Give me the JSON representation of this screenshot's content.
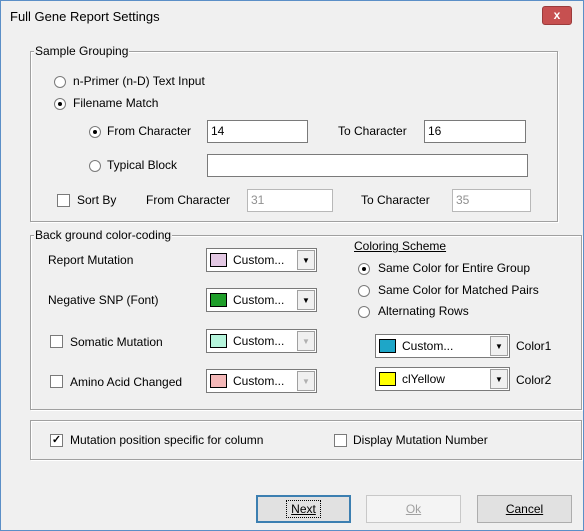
{
  "window": {
    "title": "Full Gene Report Settings",
    "close_glyph": "x"
  },
  "sample_grouping": {
    "group_label": "Sample Grouping",
    "n_primer_label": "n-Primer (n-D) Text Input",
    "filename_match_label": "Filename Match",
    "from_character_label": "From Character",
    "from_character_value": "14",
    "to_character_label": "To Character",
    "to_character_value": "16",
    "typical_block_label": "Typical Block",
    "typical_block_value": "",
    "sort_by_label": "Sort By",
    "sort_from_label": "From Character",
    "sort_from_value": "31",
    "sort_to_label": "To Character",
    "sort_to_value": "35"
  },
  "background_coloring": {
    "group_label": "Back ground color-coding",
    "report_mutation_label": "Report Mutation",
    "report_mutation_combo": "Custom...",
    "report_mutation_color": "#e3c8e3",
    "negative_snp_label": "Negative SNP (Font)",
    "negative_snp_combo": "Custom...",
    "negative_snp_color": "#1f9e2a",
    "somatic_mutation_label": "Somatic Mutation",
    "somatic_mutation_combo": "Custom...",
    "somatic_mutation_color": "#b6f5dc",
    "amino_acid_label": "Amino Acid Changed",
    "amino_acid_combo": "Custom...",
    "amino_acid_color": "#f4b8b8",
    "coloring_scheme_label": "Coloring Scheme",
    "same_color_group_label": "Same Color for Entire Group",
    "same_color_pairs_label": "Same Color for Matched Pairs",
    "alternating_rows_label": "Alternating Rows",
    "color1_combo": "Custom...",
    "color1_swatch": "#1ea6c8",
    "color1_label": "Color1",
    "color2_combo": "clYellow",
    "color2_swatch": "#ffff00",
    "color2_label": "Color2"
  },
  "options": {
    "mutation_position_label": "Mutation position specific for column",
    "display_mutation_number_label": "Display  Mutation Number"
  },
  "buttons": {
    "next_label": "Next",
    "ok_label": "Ok",
    "cancel_label": "Cancel"
  }
}
